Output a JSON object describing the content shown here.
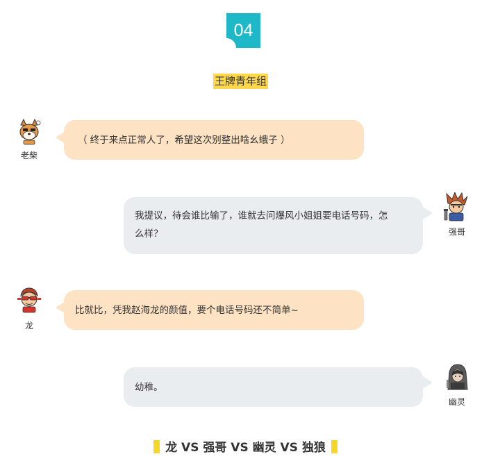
{
  "section": {
    "number": "04",
    "title": "王牌青年组"
  },
  "messages": [
    {
      "speaker": "老柴",
      "avatar_icon": "shiba-dog-avatar-icon",
      "text": "（ 终于来点正常人了，希望这次别整出啥幺蛾子 ）"
    },
    {
      "speaker": "强哥",
      "avatar_icon": "spiky-hair-boy-avatar-icon",
      "text_line1": "我提议，待会谁比输了，谁就去问爆风小姐姐要电话号码，怎",
      "text_line2": "么样？"
    },
    {
      "speaker": "龙",
      "avatar_icon": "sunglasses-man-avatar-icon",
      "text": "比就比，凭我赵海龙的颜值，要个电话号码还不简单~"
    },
    {
      "speaker": "幽灵",
      "avatar_icon": "hooded-ghost-avatar-icon",
      "text": "幼稚。"
    }
  ],
  "footer": {
    "matchup": "龙 VS 强哥 VS 幽灵 VS 独狼"
  },
  "colors": {
    "badge": "#1fb8c9",
    "title_highlight": "#ffd84a",
    "left_bubble": "#fde3c4",
    "right_bubble": "#e9edf0",
    "footer_bar": "#f5d62a"
  }
}
